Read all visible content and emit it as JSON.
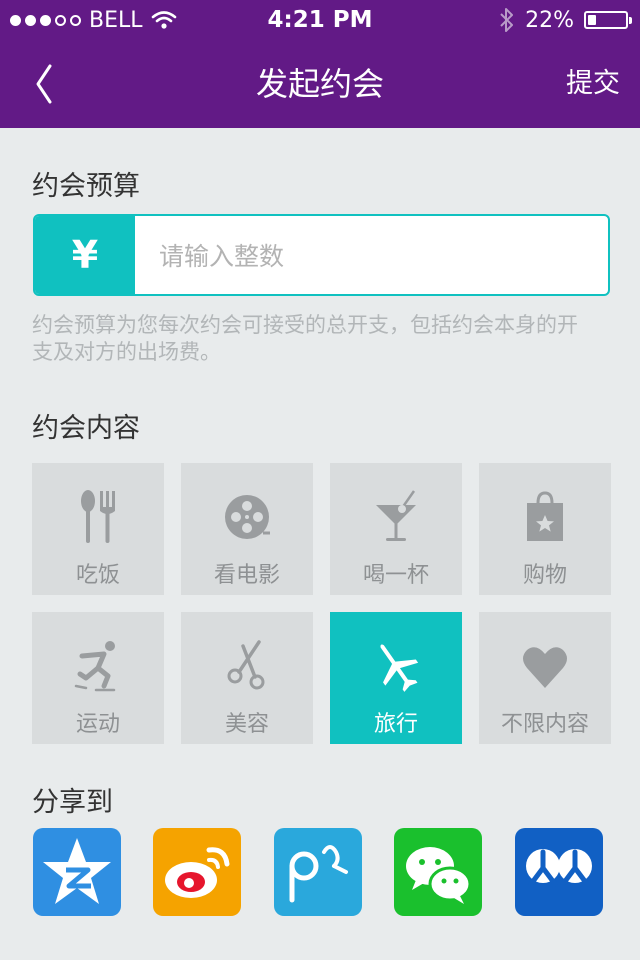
{
  "status_bar": {
    "carrier": "BELL",
    "time": "4:21 PM",
    "battery": "22%",
    "battery_level": 0.22
  },
  "nav": {
    "title": "发起约会",
    "submit": "提交"
  },
  "budget": {
    "label": "约会预算",
    "currency_symbol": "¥",
    "placeholder": "请输入整数",
    "hint": "约会预算为您每次约会可接受的总开支，包括约会本身的开支及对方的出场费。"
  },
  "content": {
    "label": "约会内容",
    "items": [
      {
        "label": "吃饭",
        "icon": "fork-spoon-icon"
      },
      {
        "label": "看电影",
        "icon": "film-reel-icon"
      },
      {
        "label": "喝一杯",
        "icon": "cocktail-icon"
      },
      {
        "label": "购物",
        "icon": "shopping-bag-icon"
      },
      {
        "label": "运动",
        "icon": "skater-icon"
      },
      {
        "label": "美容",
        "icon": "scissors-icon"
      },
      {
        "label": "旅行",
        "icon": "airplane-icon",
        "selected": true
      },
      {
        "label": "不限内容",
        "icon": "heart-icon"
      }
    ]
  },
  "share": {
    "label": "分享到",
    "targets": [
      "qzone-icon",
      "weibo-icon",
      "tencent-weibo-icon",
      "wechat-icon",
      "renren-icon"
    ]
  },
  "colors": {
    "nav": "#621a86",
    "accent": "#10c1c0",
    "background": "#e8ebec",
    "tile": "#d9dcdd"
  }
}
